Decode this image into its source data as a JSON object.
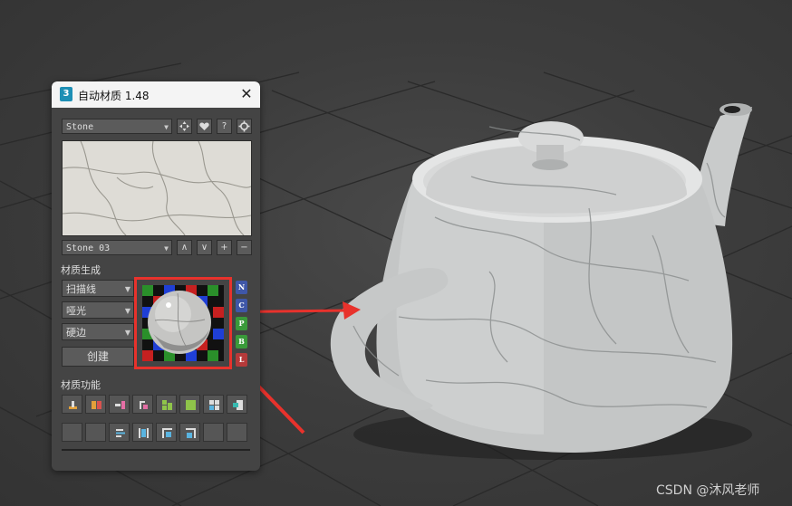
{
  "window": {
    "title": "自动材质 1.48",
    "app_icon_label": "3",
    "close_label": "✕"
  },
  "library": {
    "category": "Stone",
    "material": "Stone 03"
  },
  "top_icons": [
    "move-icon",
    "heart-icon",
    "help-icon",
    "settings-icon"
  ],
  "material_buttons": [
    "∧",
    "∨",
    "+",
    "−"
  ],
  "generation": {
    "section_label": "材质生成",
    "renderer": "扫描线",
    "shading": "哑光",
    "edges": "硬边",
    "create_label": "创建"
  },
  "map_buttons": [
    {
      "label": "N",
      "color": "#3f57a8"
    },
    {
      "label": "C",
      "color": "#3f57a8"
    },
    {
      "label": "P",
      "color": "#3a9a3a"
    },
    {
      "label": "B",
      "color": "#3a9a3a"
    },
    {
      "label": "L",
      "color": "#b53a3a"
    }
  ],
  "functions": {
    "section_label": "材质功能"
  },
  "watermark": "CSDN @沐风老师"
}
